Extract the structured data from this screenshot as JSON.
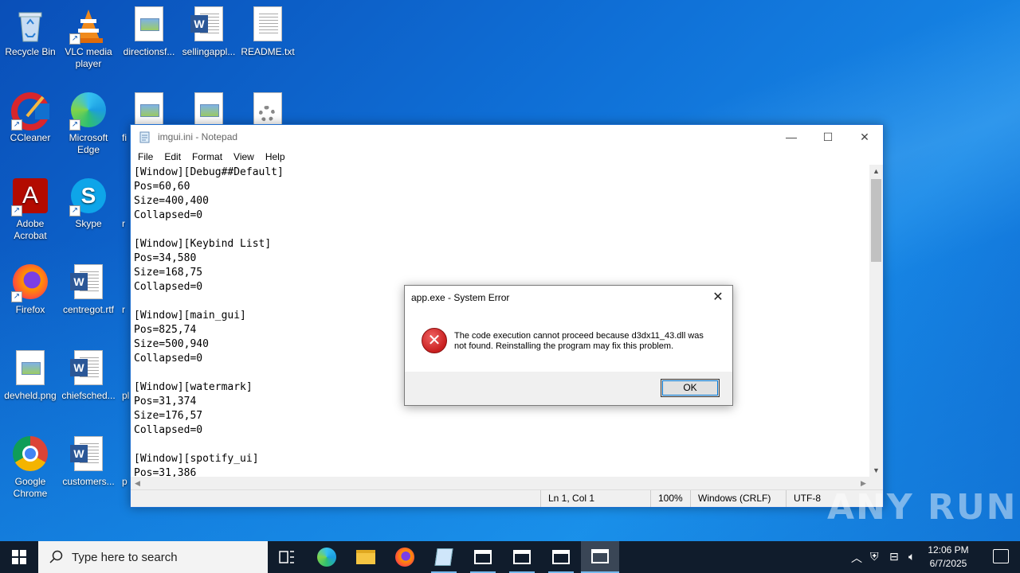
{
  "desktop": {
    "icons": [
      {
        "label": "Recycle Bin",
        "icon": "recycle-bin-icon"
      },
      {
        "label": "VLC media player",
        "icon": "vlc-icon"
      },
      {
        "label": "directionsf...",
        "icon": "image-file-icon"
      },
      {
        "label": "sellingappl...",
        "icon": "word-document-icon"
      },
      {
        "label": "README.txt",
        "icon": "text-file-icon"
      },
      {
        "label": "CCleaner",
        "icon": "ccleaner-icon"
      },
      {
        "label": "Microsoft Edge",
        "icon": "edge-icon"
      },
      {
        "label": "fi",
        "icon": "image-file-icon"
      },
      {
        "label": "Adobe Acrobat",
        "icon": "acrobat-icon"
      },
      {
        "label": "Skype",
        "icon": "skype-icon"
      },
      {
        "label": "r",
        "icon": "file-icon"
      },
      {
        "label": "Firefox",
        "icon": "firefox-icon"
      },
      {
        "label": "centregot.rtf",
        "icon": "word-document-icon"
      },
      {
        "label": "r",
        "icon": "file-icon"
      },
      {
        "label": "devheld.png",
        "icon": "image-file-icon"
      },
      {
        "label": "chiefsched...",
        "icon": "word-document-icon"
      },
      {
        "label": "pl",
        "icon": "file-icon"
      },
      {
        "label": "Google Chrome",
        "icon": "chrome-icon"
      },
      {
        "label": "customers...",
        "icon": "word-document-icon"
      },
      {
        "label": "p",
        "icon": "file-icon"
      }
    ]
  },
  "notepad": {
    "title": "imgui.ini - Notepad",
    "menu": [
      "File",
      "Edit",
      "Format",
      "View",
      "Help"
    ],
    "content": "[Window][Debug##Default]\nPos=60,60\nSize=400,400\nCollapsed=0\n\n[Window][Keybind List]\nPos=34,580\nSize=168,75\nCollapsed=0\n\n[Window][main_gui]\nPos=825,74\nSize=500,940\nCollapsed=0\n\n[Window][watermark]\nPos=31,374\nSize=176,57\nCollapsed=0\n\n[Window][spotify_ui]\nPos=31,386",
    "status": {
      "position": "Ln 1, Col 1",
      "zoom": "100%",
      "line_endings": "Windows (CRLF)",
      "encoding": "UTF-8"
    }
  },
  "dialog": {
    "title": "app.exe - System Error",
    "message": "The code execution cannot proceed because d3dx11_43.dll was not found. Reinstalling the program may fix this problem.",
    "ok_label": "OK",
    "icon": "error-icon"
  },
  "watermark": "ANY RUN",
  "taskbar": {
    "search_placeholder": "Type here to search",
    "time": "12:06 PM",
    "date": "6/7/2025",
    "colors": {
      "taskbar": "#101c2c",
      "accent": "#76b9ed"
    }
  }
}
